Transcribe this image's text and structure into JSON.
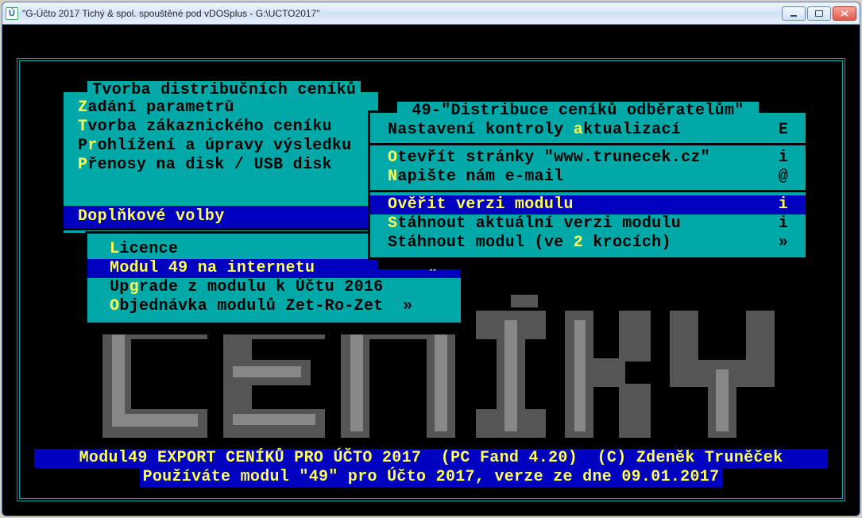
{
  "window": {
    "title": "\"G-Účto 2017 Tichý & spol. spouštěné pod vDOSplus - G:\\UCTO2017\"",
    "icon_letter": "Ú"
  },
  "menu1": {
    "title": " Tvorba distribučních ceníků ",
    "items": [
      {
        "hot": "Z",
        "rest": "adání parametrů"
      },
      {
        "hot": "T",
        "rest": "vorba zákaznického ceníku"
      },
      {
        "pre": "P",
        "hot": "r",
        "rest": "ohlížení a úpravy výsledku"
      },
      {
        "hot": "P",
        "rest": "řenosy na disk / USB disk"
      }
    ]
  },
  "supbar": {
    "label": "Doplňkové volby"
  },
  "menu2": {
    "items": [
      {
        "hot": "L",
        "rest": "icence",
        "sel": false
      },
      {
        "hot": "M",
        "rest": "odul 49 na internetu",
        "sel": true,
        "rhs": "»"
      },
      {
        "pre": "Up",
        "hot": "g",
        "rest": "rade z modulu k Účtu 2016",
        "sel": false
      },
      {
        "hot": "O",
        "rest": "bjednávka modulů Zet-Ro-Zet  »",
        "sel": false
      }
    ]
  },
  "menu3": {
    "title": " 49-\"Distribuce ceníků odběratelům\" ",
    "groups": [
      [
        {
          "pre": "Nastavení kontroly ",
          "hot": "a",
          "rest": "ktualizací",
          "rhs": "E",
          "sel": false
        }
      ],
      [
        {
          "hot": "O",
          "rest": "tevřít stránky \"www.trunecek.cz\"",
          "rhs": "i",
          "sel": false
        },
        {
          "hot": "N",
          "rest": "apište nám e-mail",
          "rhs": "@",
          "sel": false
        }
      ],
      [
        {
          "hot": "O",
          "rest": "věřit verzi modulu",
          "rhs": "i",
          "sel": true
        },
        {
          "hot": "S",
          "rest": "táhnout aktuální verzi modulu",
          "rhs": "i",
          "sel": false
        },
        {
          "pre": "Stáhnout modul (ve ",
          "hot": "2",
          "rest": " krocích)",
          "rhs": "»",
          "sel": false
        }
      ]
    ]
  },
  "footer": {
    "line1": "Modul49 EXPORT CENÍKŮ PRO ÚČTO 2017  (PC Fand 4.20)  (C) Zdeněk Truněček",
    "line2": "Používáte modul \"49\" pro Účto 2017, verze ze dne 09.01.2017"
  }
}
